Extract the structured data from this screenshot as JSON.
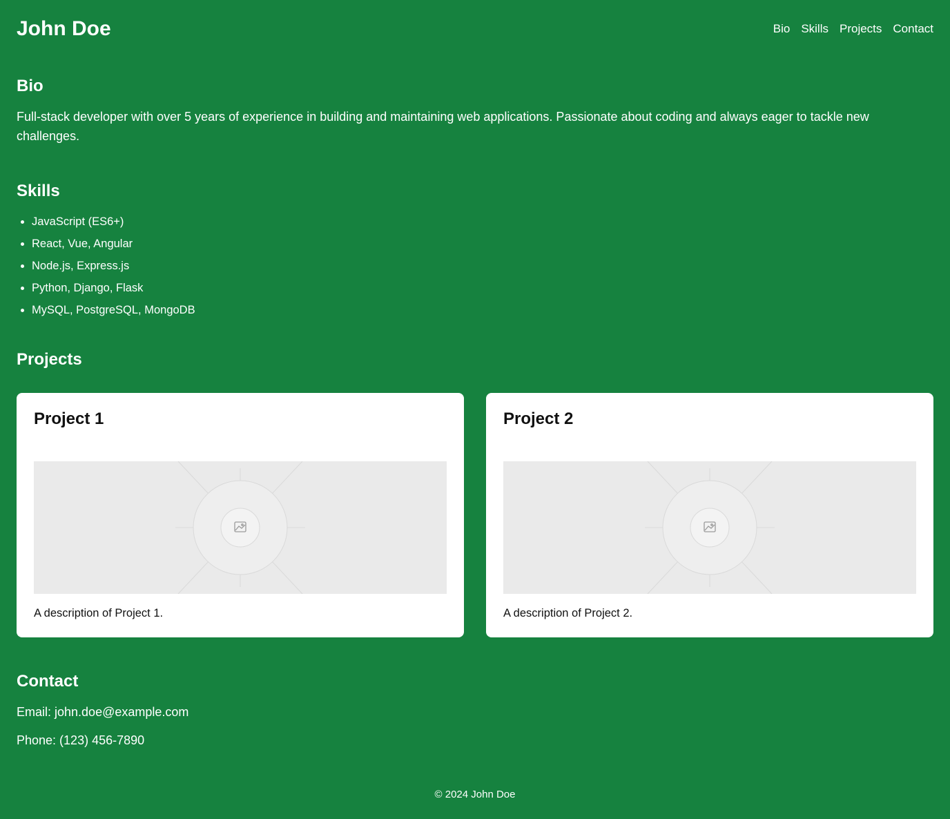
{
  "header": {
    "title": "John Doe",
    "nav": [
      "Bio",
      "Skills",
      "Projects",
      "Contact"
    ]
  },
  "bio": {
    "heading": "Bio",
    "text": "Full-stack developer with over 5 years of experience in building and maintaining web applications. Passionate about coding and always eager to tackle new challenges."
  },
  "skills": {
    "heading": "Skills",
    "items": [
      "JavaScript (ES6+)",
      "React, Vue, Angular",
      "Node.js, Express.js",
      "Python, Django, Flask",
      "MySQL, PostgreSQL, MongoDB"
    ]
  },
  "projects": {
    "heading": "Projects",
    "items": [
      {
        "title": "Project 1",
        "description": "A description of Project 1.",
        "image_icon": "image-placeholder-icon"
      },
      {
        "title": "Project 2",
        "description": "A description of Project 2.",
        "image_icon": "image-placeholder-icon"
      }
    ]
  },
  "contact": {
    "heading": "Contact",
    "email": "Email: john.doe@example.com",
    "phone": "Phone: (123) 456-7890"
  },
  "footer": {
    "text": "© 2024 John Doe"
  },
  "colors": {
    "background": "#16823f",
    "card": "#ffffff",
    "placeholder": "#eaeaea"
  }
}
